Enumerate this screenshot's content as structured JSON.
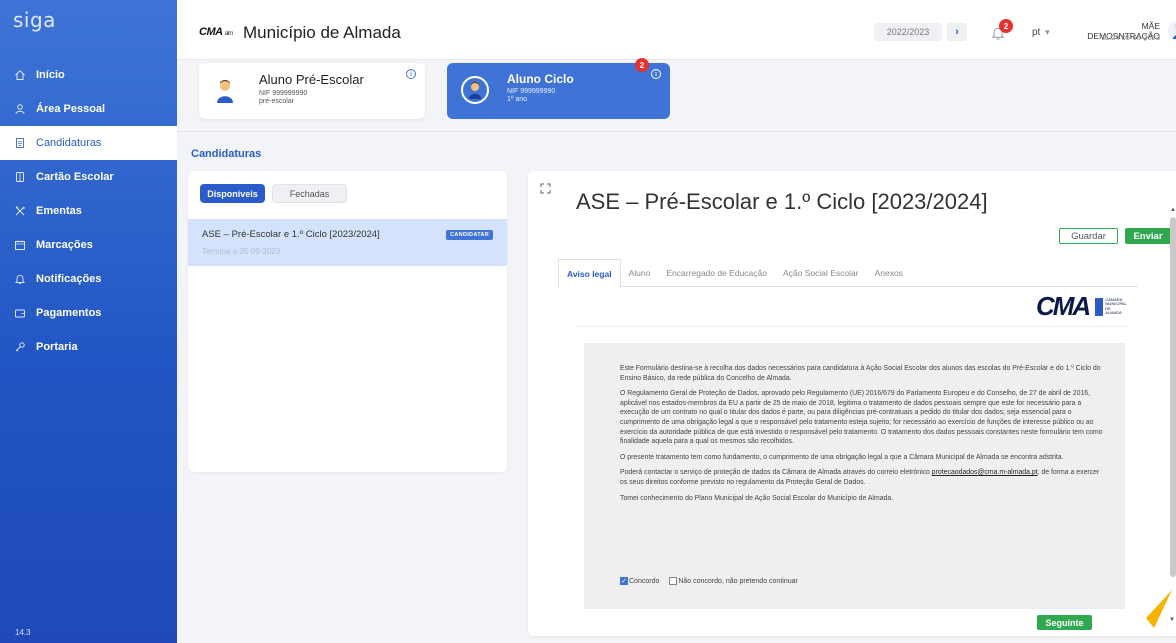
{
  "app": {
    "logo": "siga",
    "version": "14.3"
  },
  "sidebar": {
    "items": [
      {
        "label": "Início",
        "icon": "home-icon",
        "active": false
      },
      {
        "label": "Área Pessoal",
        "icon": "user-icon",
        "active": false
      },
      {
        "label": "Candidaturas",
        "icon": "document-icon",
        "active": true
      },
      {
        "label": "Cartão Escolar",
        "icon": "card-icon",
        "active": false
      },
      {
        "label": "Ementas",
        "icon": "cutlery-icon",
        "active": false
      },
      {
        "label": "Marcações",
        "icon": "calendar-icon",
        "active": false
      },
      {
        "label": "Notificações",
        "icon": "bell-icon",
        "active": false
      },
      {
        "label": "Pagamentos",
        "icon": "wallet-icon",
        "active": false
      },
      {
        "label": "Portaria",
        "icon": "key-icon",
        "active": false
      }
    ]
  },
  "header": {
    "brand": "CMA",
    "brand_sub": "alm",
    "municipality": "Município de Almada",
    "school_year": "2022/2023",
    "notifications_count": "2",
    "language": "pt",
    "user_name": "MÃE DEMOSNTRAÇÃO",
    "user_datetime": "11:24 05-06-2023"
  },
  "students": [
    {
      "name": "Aluno Pré-Escolar",
      "nif": "NIF 999999990",
      "level": "pré-escolar",
      "selected": false
    },
    {
      "name": "Aluno Ciclo",
      "nif": "NIF 999999990",
      "level": "1º ano",
      "selected": true,
      "badge": "2"
    }
  ],
  "page_title": "Candidaturas",
  "list": {
    "tabs": [
      "Disponíveis",
      "Fechadas"
    ],
    "active_tab": "Disponíveis",
    "items": [
      {
        "title": "ASE – Pré-Escolar e 1.º Ciclo [2023/2024]",
        "subtitle": "Termina a 05-09-2023",
        "action": "CANDIDATAR"
      }
    ]
  },
  "detail": {
    "title": "ASE – Pré-Escolar e 1.º Ciclo [2023/2024]",
    "save_label": "Guardar",
    "submit_label": "Enviar",
    "tabs": [
      "Aviso legal",
      "Aluno",
      "Encarregado de Educação",
      "Ação Social Escolar",
      "Anexos"
    ],
    "active_tab": "Aviso legal",
    "logo_text": "CMA",
    "logo_sub": "CÂMARA MUNICIPAL DE ALMADA",
    "paragraphs": [
      "Este Formulário destina-se à recolha dos dados necessários para candidatura à Ação Social Escolar dos alunos das escolas do Pré-Escolar e do 1.º Ciclo do Ensino Básico, da rede pública do Concelho de Almada.",
      "O Regulamento Geral de Proteção de Dados, aprovado pelo Regulamento (UE) 2016/679 do Parlamento Europeu e do Conselho, de 27 de abril de 2016, aplicável nos estados-membros da EU a partir de 25 de maio de 2018, legitima o tratamento de dados pessoais sempre que este for necessário para a execução de um contrato no qual o titular dos dados é parte, ou para diligências pré-contratuais a pedido do titular dos dados; seja essencial para o cumprimento de uma obrigação legal a que o responsável pelo tratamento esteja sujeito; for necessário ao exercício de funções de interesse público ou ao exercício da autoridade pública de que está investido o responsável pelo tratamento. O tratamento dos dados pessoais constantes neste formulário tem como finalidade aquela para a qual os mesmos são recolhidos.",
      "O presente tratamento tem como fundamento, o cumprimento de uma obrigação legal a que a Câmara Municipal de Almada se encontra adstrita."
    ],
    "contact_prefix": "Poderá contactar o serviço de proteção de dados da Câmara de Almada através do correio eletrónico ",
    "contact_email": "protecaodados@cma.m-almada.pt",
    "contact_suffix": ", de forma a exercer os seus direitos conforme previsto no regulamento da Proteção Geral de Dados.",
    "acknowledgement": "Tomei conhecimento do Plano Municipal de Ação Social Escolar do Município de Almada.",
    "agree_label": "Concordo",
    "disagree_label": "Não concordo, não pretendo continuar",
    "agree_checked": true,
    "next_label": "Seguinte"
  },
  "colors": {
    "primary": "#2a5bc8",
    "sidebar": "#3f74d6",
    "success": "#2fa84f",
    "badge": "#e5312f"
  }
}
